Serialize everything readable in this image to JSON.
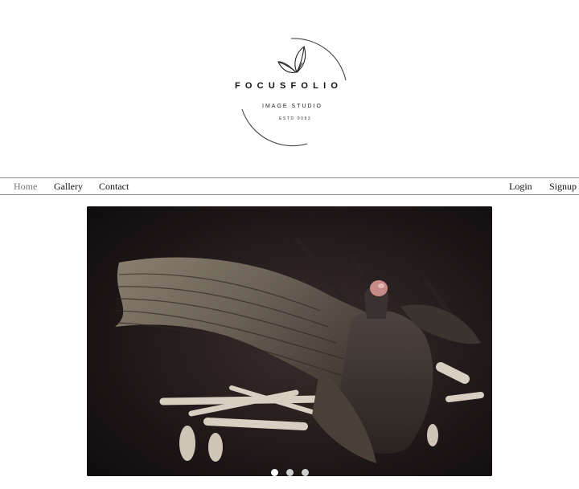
{
  "brand": {
    "name": "FOCUSFOLIO",
    "tagline": "IMAGE STUDIO",
    "established": "ESTD 9083",
    "logo_icon": "leaf-icon"
  },
  "nav": {
    "left": [
      {
        "label": "Home",
        "active": true
      },
      {
        "label": "Gallery",
        "active": false
      },
      {
        "label": "Contact",
        "active": false
      }
    ],
    "right": [
      {
        "label": "Login"
      },
      {
        "label": "Signup"
      }
    ]
  },
  "carousel": {
    "slide_count": 3,
    "active_slide": 0,
    "colors": {
      "dot_active": "#ffffff",
      "dot_inactive": "#cfcfcf"
    }
  }
}
